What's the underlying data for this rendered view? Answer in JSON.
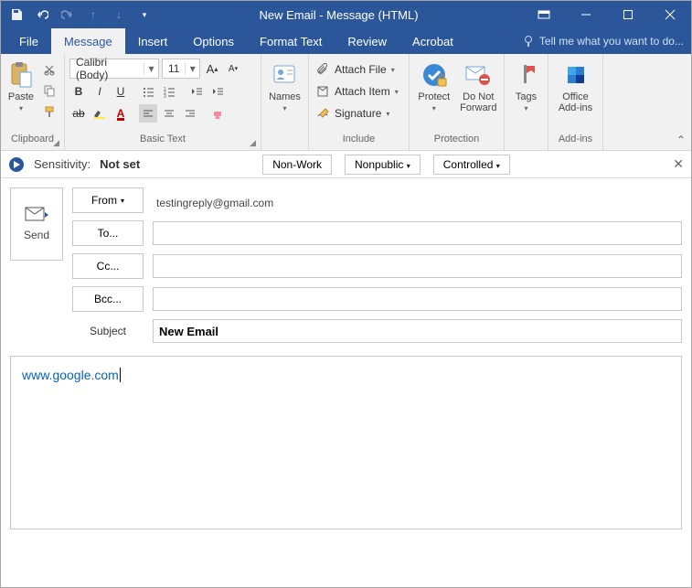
{
  "title": "New Email  - Message (HTML)",
  "tabs": {
    "file": "File",
    "message": "Message",
    "insert": "Insert",
    "options": "Options",
    "format": "Format Text",
    "review": "Review",
    "acrobat": "Acrobat",
    "tellme": "Tell me what you want to do..."
  },
  "ribbon": {
    "clipboard": {
      "paste": "Paste",
      "label": "Clipboard"
    },
    "basictext": {
      "font": "Calibri (Body)",
      "size": "11",
      "label": "Basic Text"
    },
    "names": {
      "names": "Names"
    },
    "include": {
      "attach_file": "Attach File",
      "attach_item": "Attach Item",
      "signature": "Signature",
      "label": "Include"
    },
    "protection": {
      "protect": "Protect",
      "dnf": "Do Not\nForward",
      "label": "Protection"
    },
    "tags": {
      "tags": "Tags"
    },
    "addins": {
      "office": "Office\nAdd-ins",
      "label": "Add-ins"
    }
  },
  "sensitivity": {
    "label": "Sensitivity:",
    "value": "Not set",
    "btn1": "Non-Work",
    "btn2": "Nonpublic",
    "btn3": "Controlled"
  },
  "compose": {
    "send": "Send",
    "from": "From",
    "from_value": "testingreply@gmail.com",
    "to": "To...",
    "cc": "Cc...",
    "bcc": "Bcc...",
    "subject_label": "Subject",
    "subject_value": "New Email",
    "body_link": "www.google.com"
  }
}
